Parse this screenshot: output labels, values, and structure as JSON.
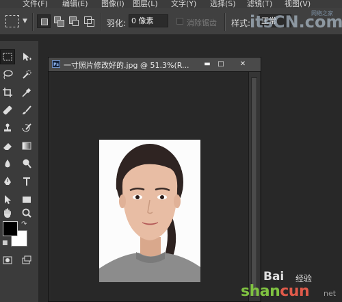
{
  "menu": {
    "items": [
      "文件(F)",
      "编辑(E)",
      "图像(I)",
      "图层(L)",
      "文字(Y)",
      "选择(S)",
      "滤镜(T)",
      "视图(V)"
    ]
  },
  "options": {
    "feather_label": "羽化:",
    "feather_value": "0 像素",
    "antialias_label": "消除锯齿",
    "style_label": "样式:",
    "style_value": "正常"
  },
  "document": {
    "title": "一寸照片修改好的.jpg @ 51.3%(R...",
    "ps_badge": "Ps",
    "minimize": "▬",
    "maximize": "□",
    "close": "✕"
  },
  "watermarks": {
    "top": "itsCN.com",
    "right": "网络之家",
    "baidu": "Bai",
    "baidu_cn": "经验",
    "bottom_1": "shan",
    "bottom_2": "cun",
    "bottom_3": "net",
    "dotcom": ".com"
  },
  "colors": {
    "foreground": "#000000",
    "background": "#ffffff",
    "ui_dark": "#282828",
    "panel": "#3b3b3b"
  },
  "tools": [
    "rect-marquee-icon",
    "move-icon",
    "lasso-icon",
    "quick-select-icon",
    "crop-icon",
    "eyedropper-icon",
    "healing-brush-icon",
    "brush-icon",
    "clone-stamp-icon",
    "history-brush-icon",
    "eraser-icon",
    "gradient-icon",
    "blur-icon",
    "dodge-icon",
    "pen-icon",
    "type-icon",
    "path-select-icon",
    "rectangle-shape-icon",
    "hand-icon",
    "zoom-icon"
  ]
}
